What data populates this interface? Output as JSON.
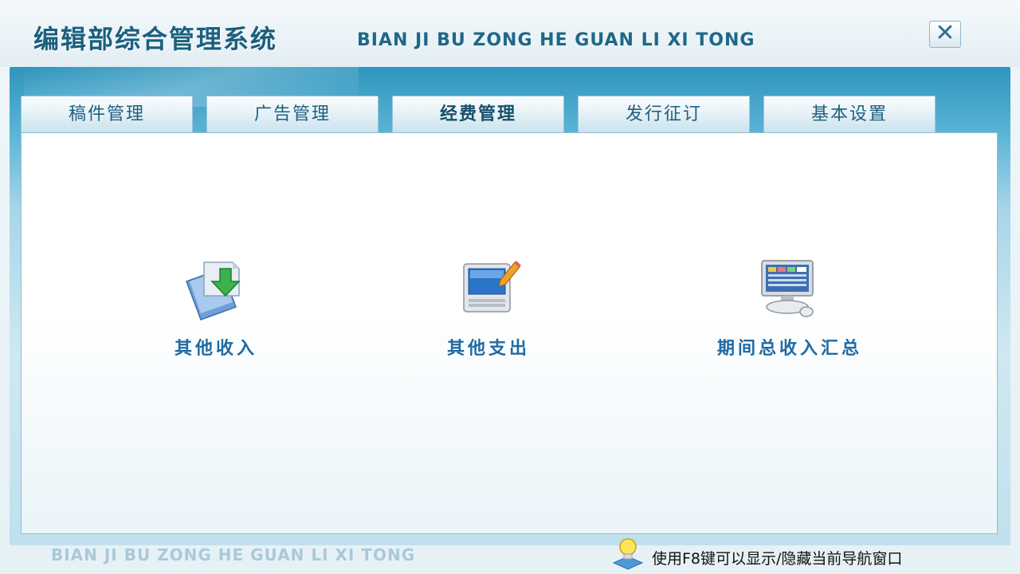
{
  "header": {
    "title_cn": "编辑部综合管理系统",
    "title_en": "BIAN JI BU ZONG HE GUAN LI XI TONG",
    "close_glyph": "✕"
  },
  "tabs": [
    {
      "label": "稿件管理",
      "active": false
    },
    {
      "label": "广告管理",
      "active": false
    },
    {
      "label": "经费管理",
      "active": true
    },
    {
      "label": "发行征订",
      "active": false
    },
    {
      "label": "基本设置",
      "active": false
    }
  ],
  "features": [
    {
      "label": "其他收入",
      "icon": "document-download-icon"
    },
    {
      "label": "其他支出",
      "icon": "computer-edit-icon"
    },
    {
      "label": "期间总收入汇总",
      "icon": "monitor-chart-icon"
    }
  ],
  "footer": {
    "brand_en": "BIAN JI BU ZONG HE GUAN LI XI TONG",
    "hint": "使用F8键可以显示/隐藏当前导航窗口",
    "hint_icon": "lightbulb-icon"
  },
  "colors": {
    "accent": "#1b5f7e",
    "feature_label": "#1f6aa3",
    "band_top": "#2f95bd"
  }
}
